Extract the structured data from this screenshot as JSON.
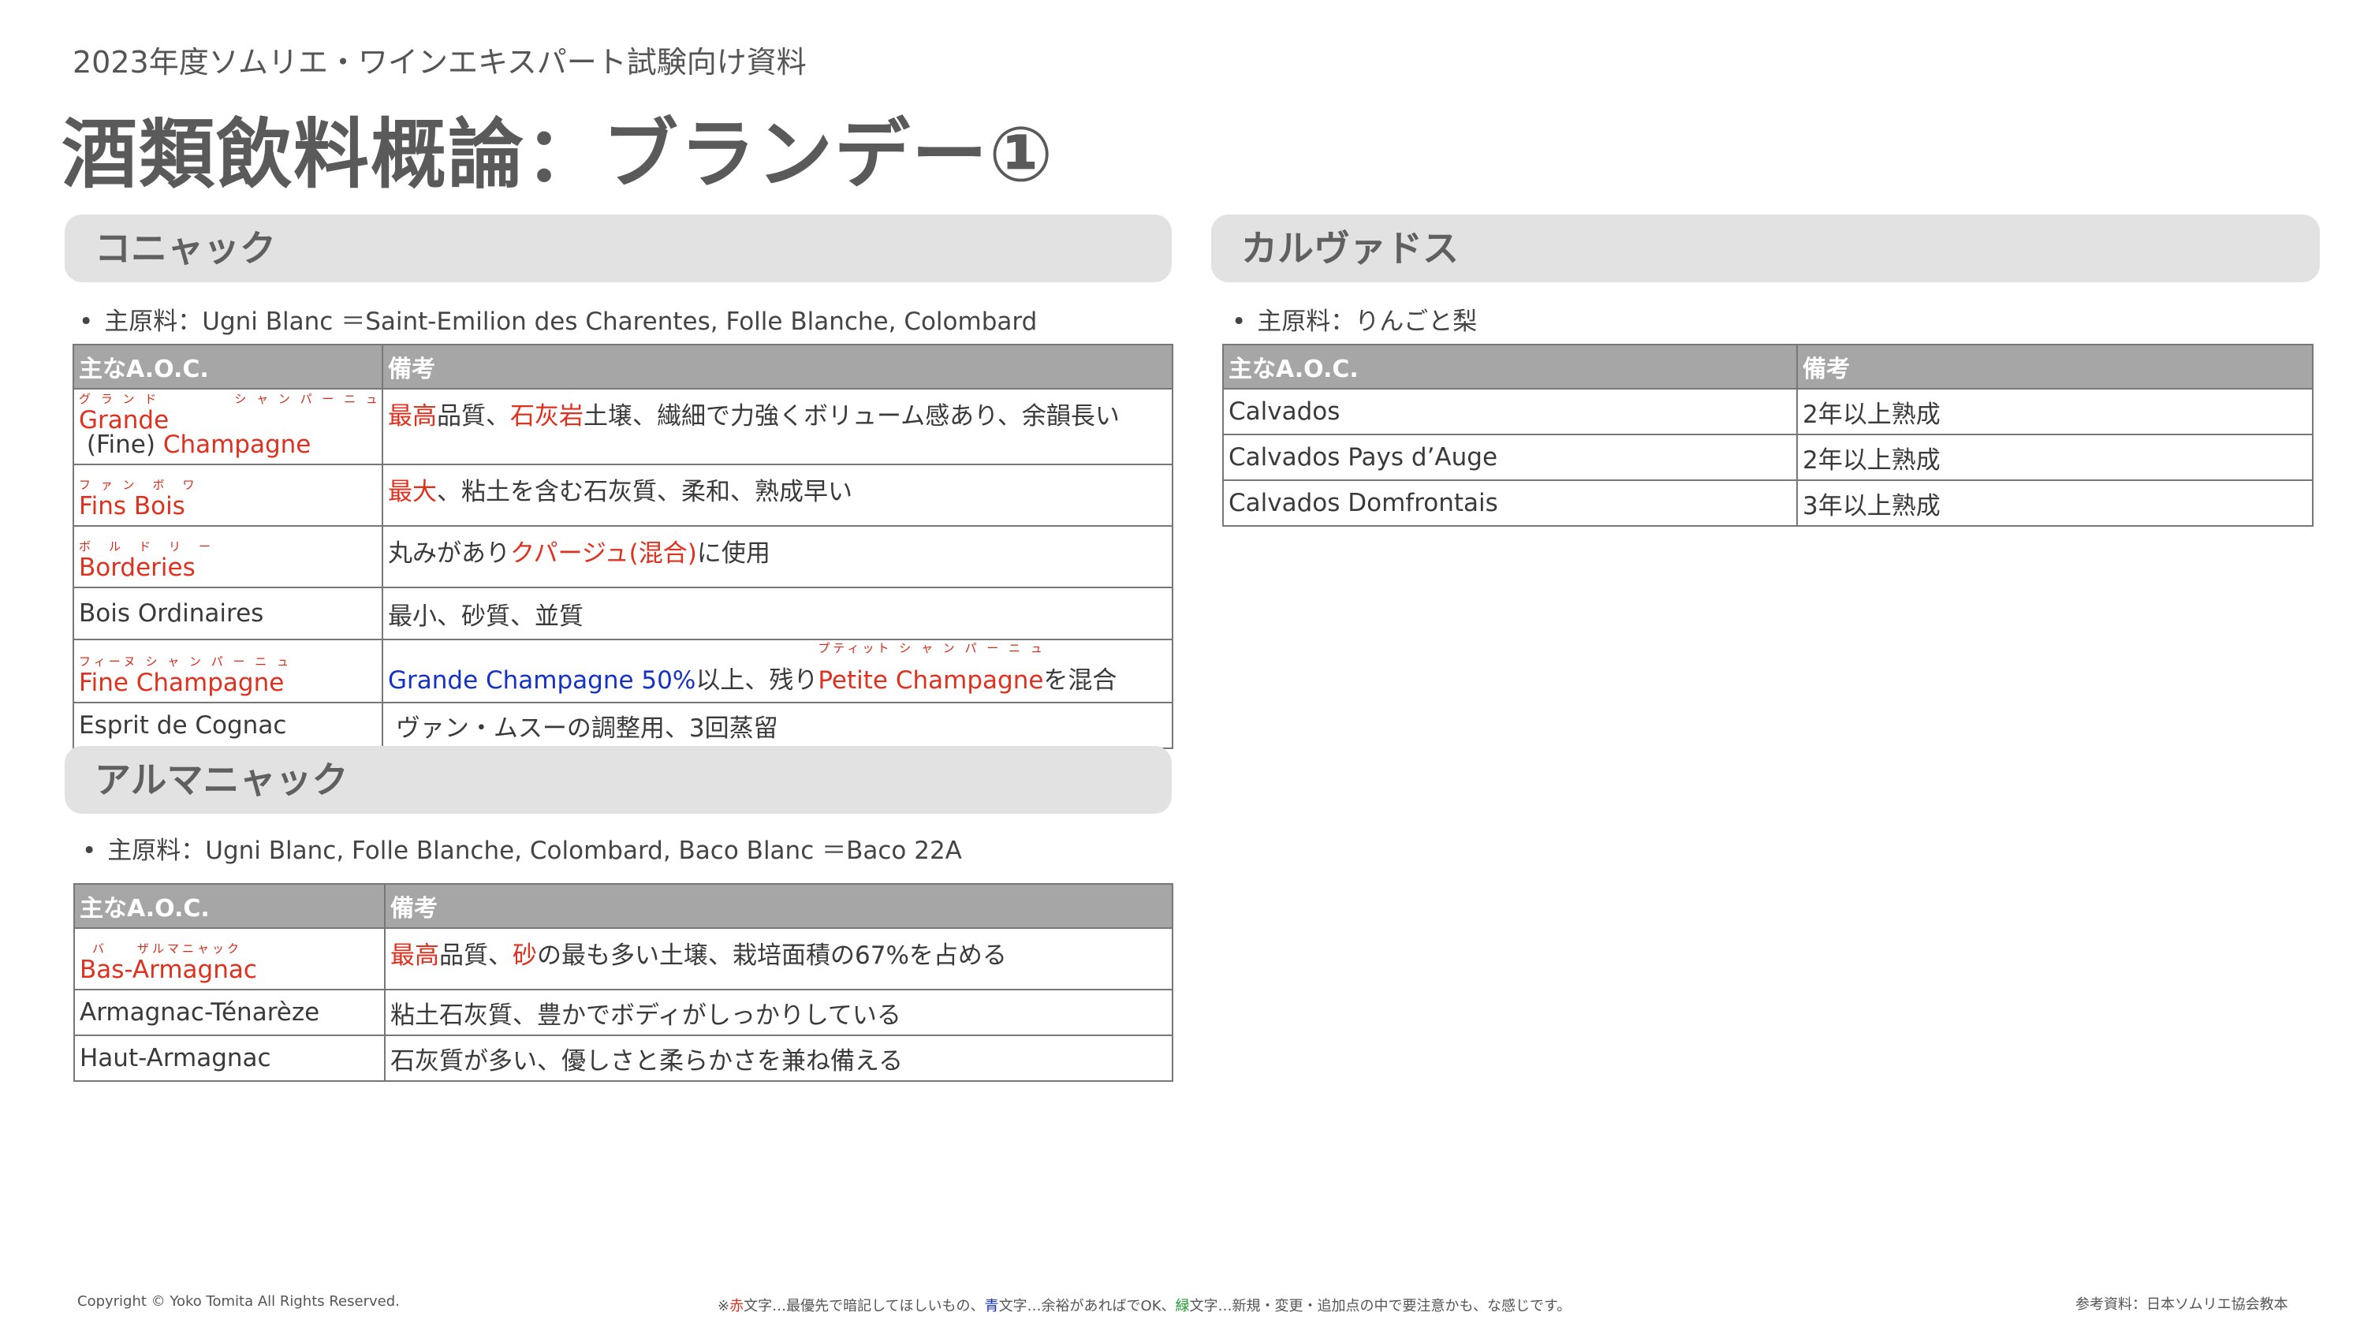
{
  "header": {
    "subtitle": "2023年度ソムリエ・ワインエキスパート試験向け資料",
    "title": "酒類飲料概論：ブランデー①"
  },
  "cognac": {
    "heading": "コニャック",
    "bullet": "主原料：Ugni Blanc ＝Saint-Emilion des Charentes, Folle Blanche, Colombard",
    "col_aoc": "主なA.O.C.",
    "col_note": "備考",
    "rows": [
      {
        "ruby1": "グ ラ ン ド",
        "ruby2": "シ ャ ン パ ー ニ ュ",
        "aoc_a": "Grande",
        "aoc_b": " (Fine) ",
        "aoc_c": "Champagne",
        "note_a": "最高",
        "note_b": "品質、",
        "note_c": "石灰岩",
        "note_d": "土壌、繊細で力強くボリューム感あり、余韻長い"
      },
      {
        "ruby": "フ ァ ン　ボ　ワ",
        "aoc": "Fins Bois",
        "note_a": "最大",
        "note_b": "、粘土を含む石灰質、柔和、熟成早い"
      },
      {
        "ruby": "ボ　ル　ド　リ　ー",
        "aoc": "Borderies",
        "note_a": "丸みがあり",
        "note_b": "クパージュ(混合)",
        "note_c": "に使用"
      },
      {
        "aoc": "Bois Ordinaires",
        "note": "最小、砂質、並質"
      },
      {
        "ruby": "フィーヌ シ ャ ン パ ー ニ ュ",
        "aoc": "Fine Champagne",
        "note_a": "Grande Champagne 50%",
        "note_b": "以上、残り",
        "note_c": "Petite Champagne",
        "note_c_ruby": "プティット シ ャ ン パ ー ニ ュ",
        "note_d": "を混合"
      },
      {
        "aoc": "Esprit de Cognac",
        "note": " ヴァン・ムスーの調整用、3回蒸留"
      }
    ]
  },
  "armagnac": {
    "heading": "アルマニャック",
    "bullet": "主原料：Ugni Blanc, Folle Blanche, Colombard, Baco Blanc ＝Baco 22A",
    "col_aoc": "主なA.O.C.",
    "col_note": "備考",
    "rows": [
      {
        "ruby": "バ　　ザルマニャック",
        "aoc": "Bas-Armagnac",
        "note_a": "最高",
        "note_b": "品質、",
        "note_c": "砂",
        "note_d": "の最も多い土壌、栽培面積の67%を占める"
      },
      {
        "aoc": "Armagnac-Ténarèze",
        "note": "粘土石灰質、豊かでボディがしっかりしている"
      },
      {
        "aoc": "Haut-Armagnac",
        "note": "石灰質が多い、優しさと柔らかさを兼ね備える"
      }
    ]
  },
  "calvados": {
    "heading": "カルヴァドス",
    "bullet": "主原料：りんごと梨",
    "col_aoc": "主なA.O.C.",
    "col_note": "備考",
    "rows": [
      {
        "aoc": "Calvados",
        "note": "2年以上熟成"
      },
      {
        "aoc": "Calvados Pays d’Auge",
        "note": "2年以上熟成"
      },
      {
        "aoc": "Calvados Domfrontais",
        "note": "3年以上熟成"
      }
    ]
  },
  "footer": {
    "copyright": "Copyright © Yoko Tomita All Rights Reserved.",
    "legend_a": "※",
    "legend_red": "赤",
    "legend_b": "文字…最優先で暗記してほしいもの、",
    "legend_blue": "青",
    "legend_c": "文字…余裕があればでOK、",
    "legend_green": "緑",
    "legend_d": "文字…新規・変更・追加点の中で要注意かも、な感じです。",
    "reference": "参考資料：日本ソムリエ協会教本"
  }
}
